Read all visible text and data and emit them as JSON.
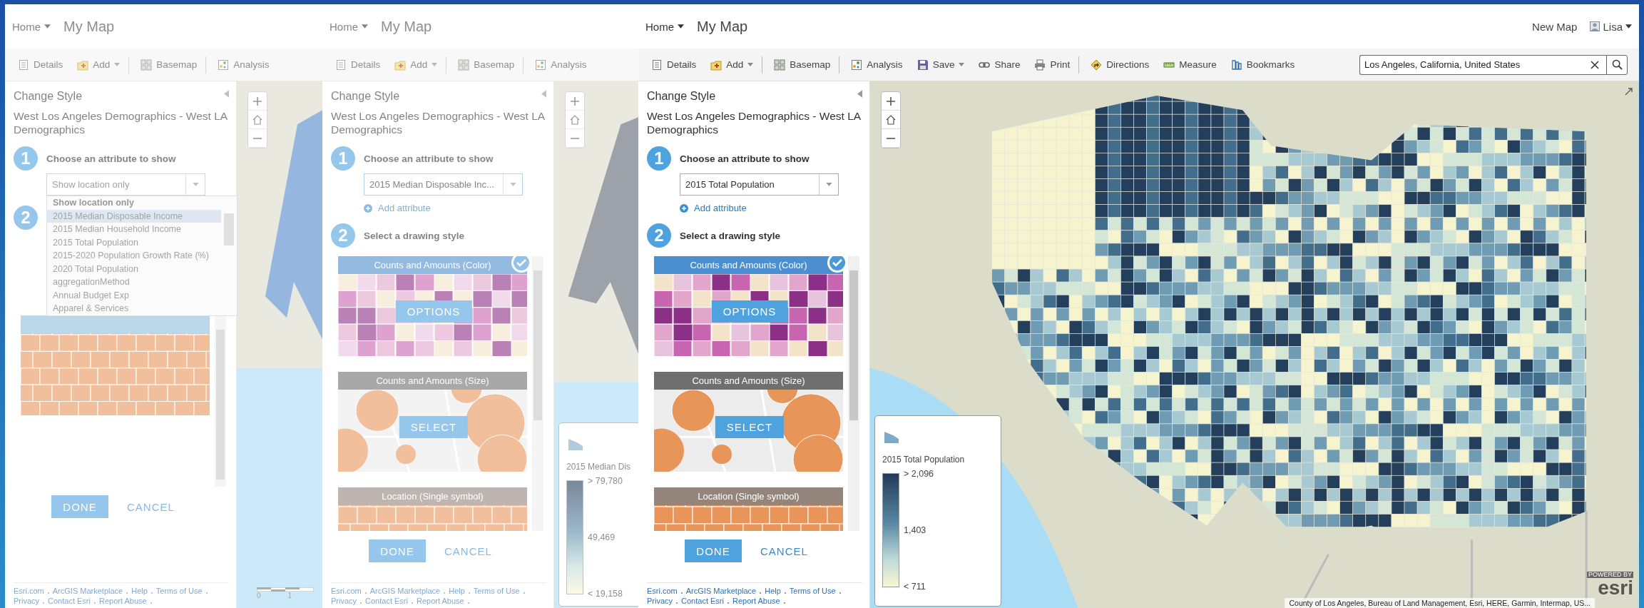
{
  "screens": [
    {
      "dimmed": true,
      "header": {
        "home": "Home",
        "title": "My Map"
      },
      "toolbar": [
        {
          "label": "Details",
          "kind": "details",
          "dropdown": false,
          "divider_after": false
        },
        {
          "label": "Add",
          "kind": "add",
          "dropdown": true,
          "divider_after": true
        },
        {
          "label": "Basemap",
          "kind": "basemap",
          "dropdown": false,
          "divider_after": true
        },
        {
          "label": "Analysis",
          "kind": "analysis",
          "dropdown": false,
          "divider_after": false
        }
      ],
      "panel": {
        "heading": "Change Style",
        "layer": "West Los Angeles Demographics - West LA Demographics",
        "step_1": {
          "number": "1",
          "label": "Choose an attribute to show"
        },
        "attribute": {
          "value": "Show location only",
          "expanded": true,
          "options": [
            {
              "label": "Show location only",
              "selected": true,
              "highlighted": false
            },
            {
              "label": "2015 Median Disposable Income",
              "selected": false,
              "highlighted": true
            },
            {
              "label": "2015 Median Household Income",
              "selected": false,
              "highlighted": false
            },
            {
              "label": "2015 Total Population",
              "selected": false,
              "highlighted": false
            },
            {
              "label": "2015-2020 Population Growth Rate (%)",
              "selected": false,
              "highlighted": false
            },
            {
              "label": "2020 Total Population",
              "selected": false,
              "highlighted": false
            },
            {
              "label": "aggregationMethod",
              "selected": false,
              "highlighted": false
            },
            {
              "label": "Annual Budget Exp",
              "selected": false,
              "highlighted": false
            },
            {
              "label": "Apparel & Services",
              "selected": false,
              "highlighted": false
            }
          ]
        },
        "step_2": {
          "number": "2"
        },
        "styles": [
          {
            "kind": "single",
            "selected": false
          }
        ],
        "done": "DONE",
        "cancel": "CANCEL",
        "footer": [
          "Esri.com",
          "ArcGIS Marketplace",
          "Help",
          "Terms of Use",
          "Privacy",
          "Contact Esri",
          "Report Abuse"
        ]
      },
      "map": {
        "kind": "location_only",
        "scale_labels": [
          "0",
          "1"
        ]
      }
    },
    {
      "dimmed": true,
      "header": {
        "home": "Home",
        "title": "My Map"
      },
      "toolbar": [
        {
          "label": "Details",
          "kind": "details",
          "dropdown": false,
          "divider_after": false
        },
        {
          "label": "Add",
          "kind": "add",
          "dropdown": true,
          "divider_after": true
        },
        {
          "label": "Basemap",
          "kind": "basemap",
          "dropdown": false,
          "divider_after": true
        },
        {
          "label": "Analysis",
          "kind": "analysis",
          "dropdown": false,
          "divider_after": false
        }
      ],
      "panel": {
        "heading": "Change Style",
        "layer": "West Los Angeles Demographics - West LA Demographics",
        "step_1": {
          "number": "1",
          "label": "Choose an attribute to show"
        },
        "attribute": {
          "value": "2015 Median Disposable Inc...",
          "expanded": false
        },
        "add_attribute": "Add attribute",
        "step_2": {
          "number": "2",
          "label": "Select a drawing style"
        },
        "styles": [
          {
            "kind": "color",
            "title": "Counts and Amounts (Color)",
            "selected": true,
            "button": "OPTIONS"
          },
          {
            "kind": "size",
            "title": "Counts and Amounts (Size)",
            "selected": false,
            "button": "SELECT"
          },
          {
            "kind": "single",
            "title": "Location (Single symbol)",
            "selected": false
          }
        ],
        "done": "DONE",
        "cancel": "CANCEL",
        "footer": [
          "Esri.com",
          "ArcGIS Marketplace",
          "Help",
          "Terms of Use",
          "Privacy",
          "Contact Esri",
          "Report Abuse"
        ]
      },
      "map": {
        "kind": "single_color",
        "legend": {
          "title": "2015 Median Dis",
          "ramp_labels": [
            "> 79,780",
            "49,469",
            "< 19,158"
          ]
        }
      }
    },
    {
      "dimmed": false,
      "header": {
        "home": "Home",
        "title": "My Map",
        "new_map": "New Map",
        "user": "Lisa"
      },
      "toolbar": [
        {
          "label": "Details",
          "kind": "details",
          "dropdown": false,
          "divider_after": false
        },
        {
          "label": "Add",
          "kind": "add",
          "dropdown": true,
          "divider_after": true
        },
        {
          "label": "Basemap",
          "kind": "basemap",
          "dropdown": false,
          "divider_after": true
        },
        {
          "label": "Analysis",
          "kind": "analysis",
          "dropdown": false,
          "divider_after": false
        },
        {
          "label": "Save",
          "kind": "save",
          "dropdown": true,
          "divider_after": false
        },
        {
          "label": "Share",
          "kind": "share",
          "dropdown": false,
          "divider_after": false
        },
        {
          "label": "Print",
          "kind": "print",
          "dropdown": false,
          "divider_after": true
        },
        {
          "label": "Directions",
          "kind": "directions",
          "dropdown": false,
          "divider_after": false
        },
        {
          "label": "Measure",
          "kind": "measure",
          "dropdown": false,
          "divider_after": false
        },
        {
          "label": "Bookmarks",
          "kind": "bookmarks",
          "dropdown": false,
          "divider_after": false
        }
      ],
      "search": {
        "value": "Los Angeles, California, United States"
      },
      "panel": {
        "heading": "Change Style",
        "layer": "West Los Angeles Demographics - West LA Demographics",
        "step_1": {
          "number": "1",
          "label": "Choose an attribute to show"
        },
        "attribute": {
          "value": "2015 Total Population",
          "expanded": false
        },
        "add_attribute": "Add attribute",
        "step_2": {
          "number": "2",
          "label": "Select a drawing style"
        },
        "styles": [
          {
            "kind": "color",
            "title": "Counts and Amounts (Color)",
            "selected": true,
            "button": "OPTIONS"
          },
          {
            "kind": "size",
            "title": "Counts and Amounts (Size)",
            "selected": false,
            "button": "SELECT"
          },
          {
            "kind": "single",
            "title": "Location (Single symbol)",
            "selected": false
          }
        ],
        "done": "DONE",
        "cancel": "CANCEL",
        "footer": [
          "Esri.com",
          "ArcGIS Marketplace",
          "Help",
          "Terms of Use",
          "Privacy",
          "Contact Esri",
          "Report Abuse"
        ]
      },
      "map": {
        "kind": "choropleth",
        "legend": {
          "title": "2015 Total Population",
          "ramp_labels": [
            "> 2,096",
            "1,403",
            "< 711"
          ]
        },
        "attribution": "County of Los Angeles, Bureau of Land Management, Esri, HERE, Garmin, Intermap, US...",
        "logo": {
          "tagline": "POWERED BY",
          "wordmark": "esri"
        }
      }
    }
  ]
}
